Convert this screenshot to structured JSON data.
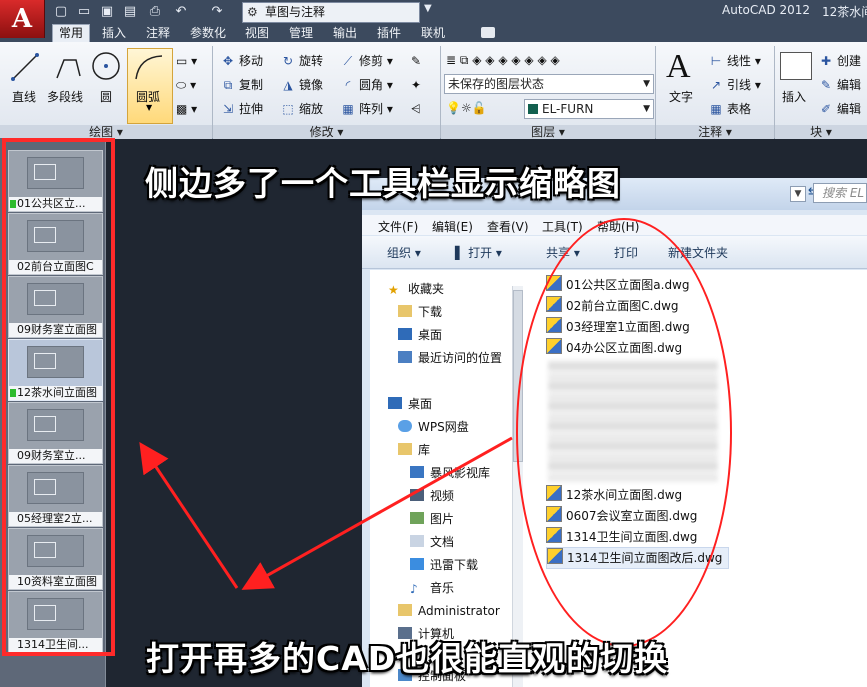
{
  "titlebar": {
    "app_button": "A",
    "workspace": "草图与注释",
    "app_title": "AutoCAD 2012",
    "doc_title": "12茶水间"
  },
  "ribbon": {
    "tabs": [
      "常用",
      "插入",
      "注释",
      "参数化",
      "视图",
      "管理",
      "输出",
      "插件",
      "联机"
    ],
    "draw": {
      "line": "直线",
      "polyline": "多段线",
      "circle": "圆",
      "arc": "圆弧",
      "group_label": "绘图"
    },
    "modify": {
      "move": "移动",
      "rotate": "旋转",
      "trim": "修剪",
      "copy": "复制",
      "mirror": "镜像",
      "fillet": "圆角",
      "stretch": "拉伸",
      "scale": "缩放",
      "array": "阵列",
      "group_label": "修改"
    },
    "layers": {
      "state": "未保存的图层状态",
      "current_layer": "EL-FURN",
      "group_label": "图层"
    },
    "annotation": {
      "text": "文字",
      "linear": "线性",
      "leader": "引线",
      "table": "表格",
      "group_label": "注释"
    },
    "block": {
      "insert": "插入",
      "create": "创建",
      "edit": "编辑",
      "edit_attr": "编辑",
      "group_label": "块"
    }
  },
  "thumbnails": [
    "01公共区立...",
    "02前台立面图C",
    "09财务室立面图",
    "12茶水间立面图",
    "09财务室立...",
    "05经理室2立...",
    "10资料室立面图",
    "1314卫生间..."
  ],
  "explorer": {
    "search_placeholder": "搜索 EL",
    "menu": [
      "文件(F)",
      "编辑(E)",
      "查看(V)",
      "工具(T)",
      "帮助(H)"
    ],
    "commands": [
      "组织",
      "打开",
      "共享",
      "打印",
      "新建文件夹"
    ],
    "nav": [
      "收藏夹",
      "下载",
      "桌面",
      "最近访问的位置",
      "桌面",
      "WPS网盘",
      "库",
      "暴风影视库",
      "视频",
      "图片",
      "文档",
      "迅雷下载",
      "音乐",
      "Administrator",
      "计算机",
      "控制面板"
    ],
    "files_top": [
      "01公共区立面图a.dwg",
      "02前台立面图C.dwg",
      "03经理室1立面图.dwg",
      "04办公区立面图.dwg"
    ],
    "files_bottom": [
      "12茶水间立面图.dwg",
      "0607会议室立面图.dwg",
      "1314卫生间立面图.dwg",
      "1314卫生间立面图改后.dwg"
    ]
  },
  "annotations": {
    "top": "侧边多了一个工具栏显示缩略图",
    "bottom": "打开再多的CAD也很能直观的切换"
  },
  "colors": {
    "highlight_red": "#ff2020",
    "ribbon_dark": "#3c4a5e"
  }
}
